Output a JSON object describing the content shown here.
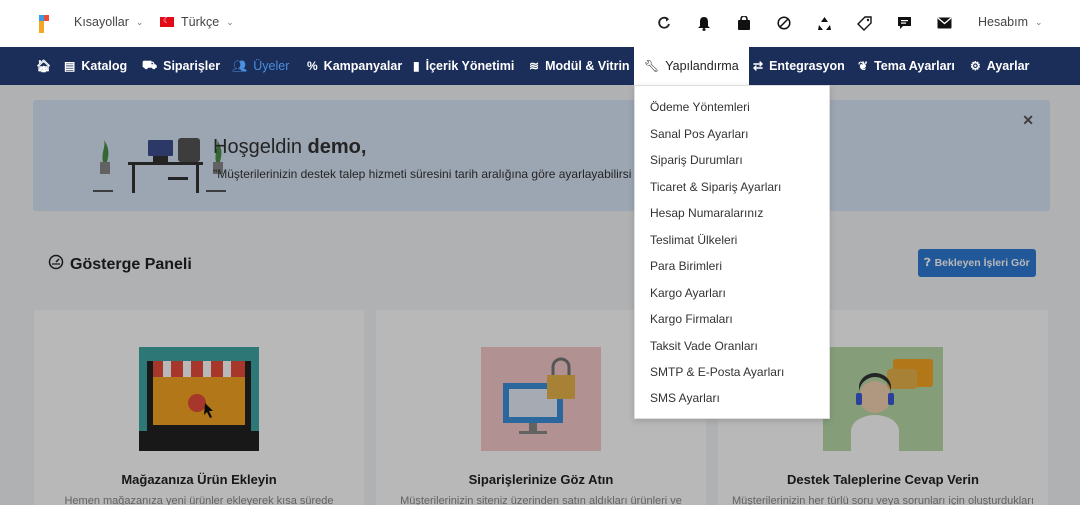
{
  "topbar": {
    "shortcuts_label": "Kısayollar",
    "language_label": "Türkçe",
    "account_label": "Hesabım"
  },
  "nav": {
    "items": [
      {
        "label": "Katalog"
      },
      {
        "label": "Siparişler"
      },
      {
        "label": "Üyeler"
      },
      {
        "label": "Kampanyalar"
      },
      {
        "label": "İçerik Yönetimi"
      },
      {
        "label": "Modül & Vitrin"
      },
      {
        "label": "Yapılandırma"
      },
      {
        "label": "Entegrasyon"
      },
      {
        "label": "Tema Ayarları"
      },
      {
        "label": "Ayarlar"
      }
    ]
  },
  "dropdown": {
    "items": [
      "Ödeme Yöntemleri",
      "Sanal Pos Ayarları",
      "Sipariş Durumları",
      "Ticaret & Sipariş Ayarları",
      "Hesap Numaralarınız",
      "Teslimat Ülkeleri",
      "Para Birimleri",
      "Kargo Ayarları",
      "Kargo Firmaları",
      "Taksit Vade Oranları",
      "SMTP & E-Posta Ayarları",
      "SMS Ayarları"
    ]
  },
  "welcome": {
    "greeting": "Hoşgeldin",
    "username": "demo,",
    "subtitle": "\"Müşterilerinizin destek talep hizmeti süresini tarih aralığına göre ayarlayabilirsi"
  },
  "dashboard": {
    "title": "Gösterge Paneli",
    "pending_button": "Bekleyen İşleri Gör"
  },
  "cards": [
    {
      "title": "Mağazanıza Ürün Ekleyin",
      "desc": "Hemen mağazanıza yeni ürünler ekleyerek kısa sürede"
    },
    {
      "title": "Siparişlerinize Göz Atın",
      "desc": "Müşterilerinizin siteniz üzerinden satın aldıkları ürünleri ve"
    },
    {
      "title": "Destek Taleplerine Cevap Verin",
      "desc": "Müşterilerinizin her türlü soru veya sorunları için oluşturdukları"
    }
  ],
  "colors": {
    "navbar": "#1b2d59",
    "accent": "#2f7ad6",
    "welcome_bg": "#d9e6f8"
  }
}
